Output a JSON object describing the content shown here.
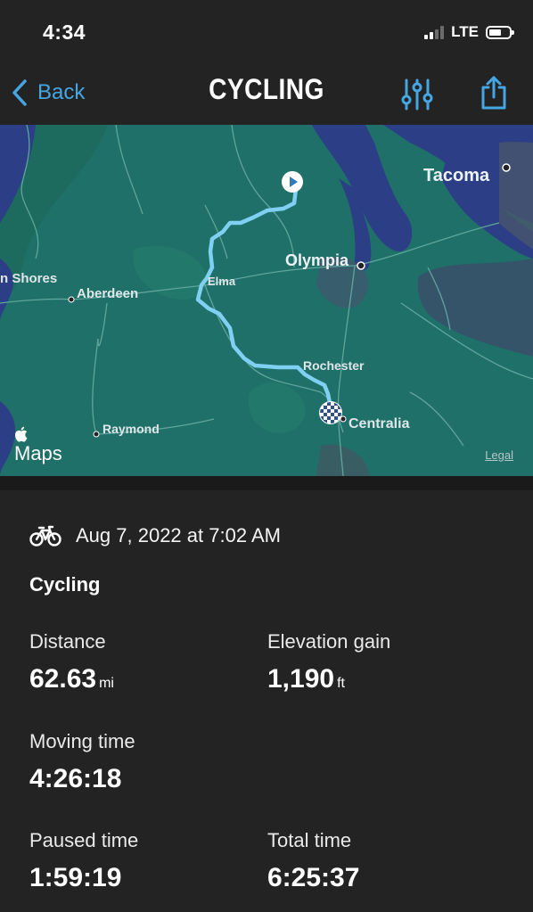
{
  "status_bar": {
    "time": "4:34",
    "network": "LTE"
  },
  "nav": {
    "back_label": "Back",
    "title": "CYCLING"
  },
  "map": {
    "labels": {
      "tacoma": "Tacoma",
      "olympia": "Olympia",
      "ocean_shores": "n Shores",
      "aberdeen": "Aberdeen",
      "elma": "Elma",
      "rochester": "Rochester",
      "centralia": "Centralia",
      "raymond": "Raymond"
    },
    "logo": "Maps",
    "legal": "Legal",
    "colors": {
      "land": "#1f7068",
      "water": "#2b3e86",
      "route": "#7fd0f2"
    }
  },
  "workout": {
    "date": "Aug 7, 2022 at 7:02 AM",
    "activity": "Cycling",
    "distance": {
      "label": "Distance",
      "value": "62.63",
      "unit": "mi"
    },
    "elevation_gain": {
      "label": "Elevation gain",
      "value": "1,190",
      "unit": "ft"
    },
    "moving_time": {
      "label": "Moving time",
      "value": "4:26:18"
    },
    "paused_time": {
      "label": "Paused time",
      "value": "1:59:19"
    },
    "total_time": {
      "label": "Total time",
      "value": "6:25:37"
    }
  }
}
